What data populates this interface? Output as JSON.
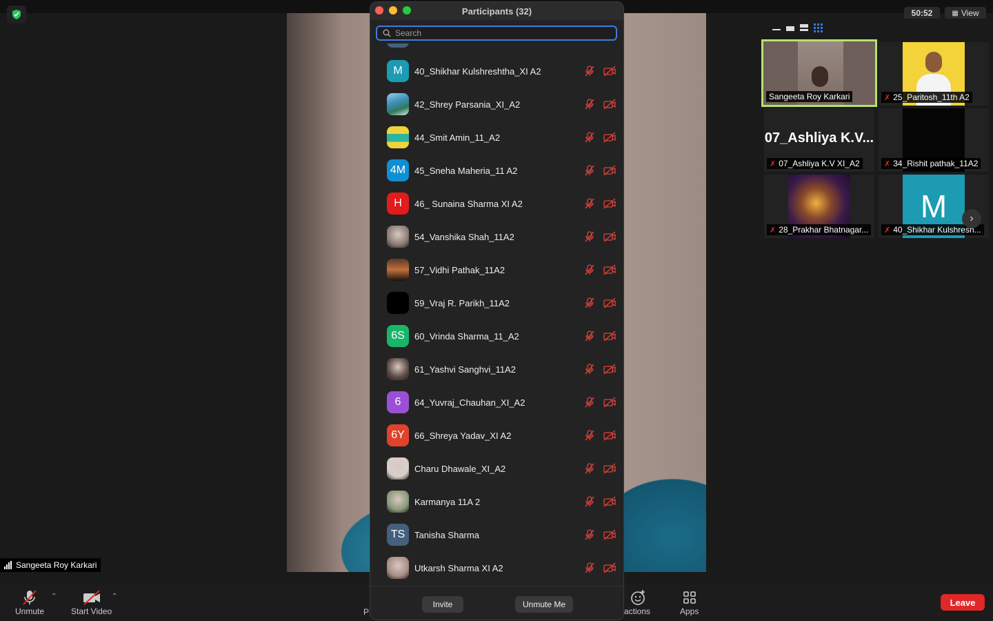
{
  "top": {
    "timer": "50:52",
    "view_label": "View"
  },
  "main": {
    "speaker_name": "Sangeeta Roy Karkari"
  },
  "toolbar": {
    "unmute": "Unmute",
    "start_video": "Start Video",
    "reactions_partial": "actions",
    "apps": "Apps",
    "hidden_partial": "P",
    "leave": "Leave"
  },
  "gallery": {
    "tiles": [
      {
        "name": "Sangeeta Roy Karkari",
        "muted": false
      },
      {
        "name": "25_Paritosh_11th A2",
        "muted": true
      },
      {
        "name": "07_Ashliya K.V XI_A2",
        "big_name": "07_Ashliya K.V...",
        "muted": true
      },
      {
        "name": "34_Rishit pathak_11A2",
        "muted": true
      },
      {
        "name": "28_Prakhar Bhatnagar...",
        "muted": true
      },
      {
        "name": "40_Shikhar Kulshresh...",
        "initial": "M",
        "muted": true
      }
    ]
  },
  "panel": {
    "title": "Participants (32)",
    "search_placeholder": "Search",
    "invite": "Invite",
    "unmute_me": "Unmute Me",
    "participants": [
      {
        "name": "40_Shikhar Kulshreshtha_XI A2",
        "initial": "M",
        "color": "#1c9bb3"
      },
      {
        "name": "42_Shrey Parsania_XI_A2",
        "initial": "",
        "color": "#3f8fb8",
        "photo": "landscape"
      },
      {
        "name": "44_Smit Amin_11_A2",
        "initial": "",
        "color": "#f0d23a",
        "photo": "emoji"
      },
      {
        "name": "45_Sneha Maheria_11 A2",
        "initial": "4M",
        "color": "#0e8fd3"
      },
      {
        "name": "46_ Sunaina Sharma XI A2",
        "initial": "H",
        "color": "#e21b1b"
      },
      {
        "name": "54_Vanshika Shah_11A2",
        "initial": "",
        "color": "#8b7d76",
        "photo": "photo"
      },
      {
        "name": "57_Vidhi Pathak_11A2",
        "initial": "",
        "color": "#3a2a22",
        "photo": "sunset"
      },
      {
        "name": "59_Vraj R. Parikh_11A2",
        "initial": "",
        "color": "#000000"
      },
      {
        "name": "60_Vrinda Sharma_11_A2",
        "initial": "6S",
        "color": "#1ab56a"
      },
      {
        "name": "61_Yashvi Sanghvi_11A2",
        "initial": "",
        "color": "#5c4a44",
        "photo": "photo"
      },
      {
        "name": "64_Yuvraj_Chauhan_XI_A2",
        "initial": "6",
        "color": "#9b4fd6"
      },
      {
        "name": "66_Shreya Yadav_XI A2",
        "initial": "6Y",
        "color": "#e0432c"
      },
      {
        "name": "Charu Dhawale_XI_A2",
        "initial": "",
        "color": "#d8d0cc",
        "photo": "photo"
      },
      {
        "name": "Karmanya 11A 2",
        "initial": "",
        "color": "#8a9a7a",
        "photo": "photo"
      },
      {
        "name": "Tanisha Sharma",
        "initial": "TS",
        "color": "#44607d"
      },
      {
        "name": "Utkarsh Sharma XI A2",
        "initial": "",
        "color": "#a88f85",
        "photo": "photo"
      }
    ]
  }
}
